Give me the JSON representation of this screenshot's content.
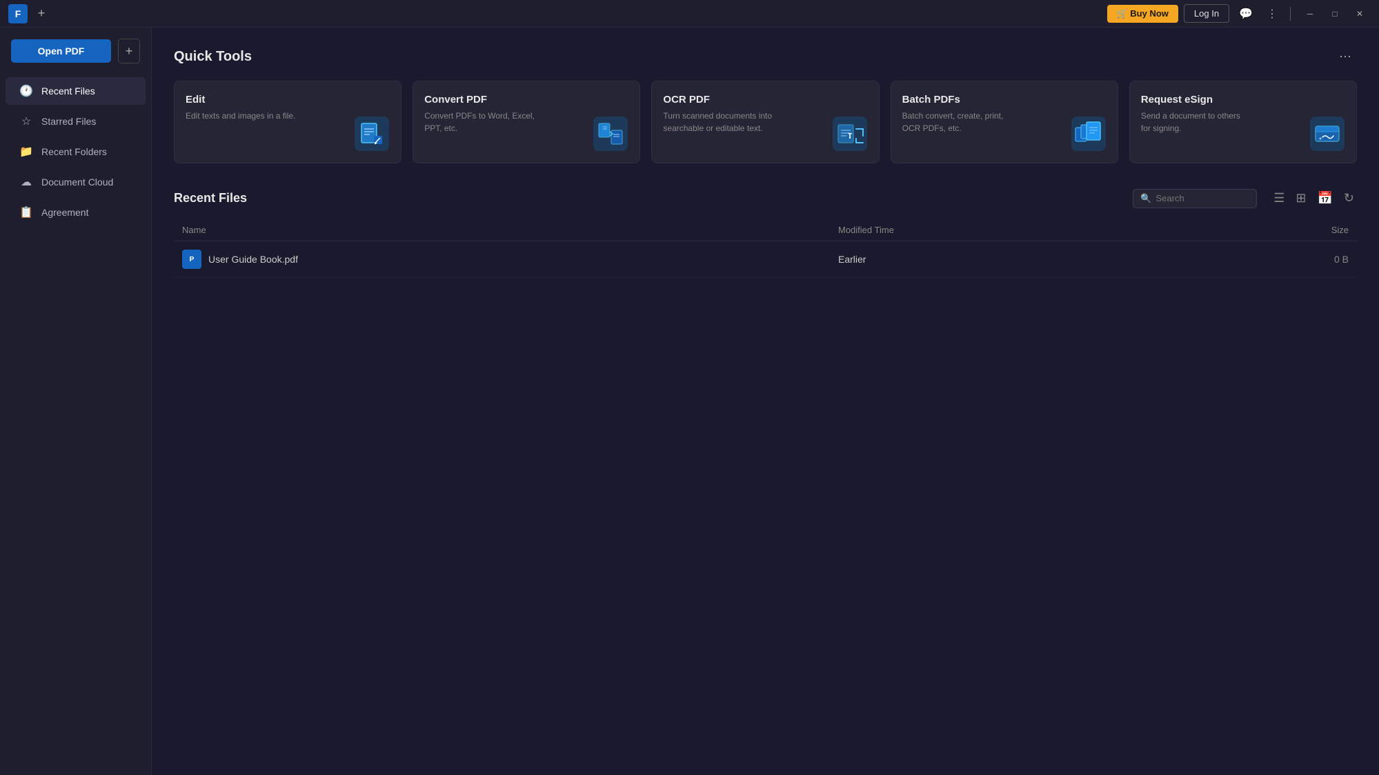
{
  "titlebar": {
    "logo_text": "F",
    "new_tab_label": "+",
    "buy_now_label": "🛒 Buy Now",
    "login_label": "Log In",
    "chat_icon": "💬",
    "more_icon": "⋮",
    "minimize_icon": "─",
    "maximize_icon": "□",
    "close_icon": "✕"
  },
  "sidebar": {
    "open_pdf_label": "Open PDF",
    "add_label": "+",
    "items": [
      {
        "id": "recent-files",
        "icon": "🕐",
        "label": "Recent Files"
      },
      {
        "id": "starred-files",
        "icon": "☆",
        "label": "Starred Files"
      },
      {
        "id": "recent-folders",
        "icon": "📁",
        "label": "Recent Folders"
      },
      {
        "id": "document-cloud",
        "icon": "☁",
        "label": "Document Cloud"
      },
      {
        "id": "agreement",
        "icon": "📋",
        "label": "Agreement"
      }
    ]
  },
  "quick_tools": {
    "section_title": "Quick Tools",
    "more_icon": "⋯",
    "cards": [
      {
        "id": "edit",
        "title": "Edit",
        "description": "Edit texts and images in a file."
      },
      {
        "id": "convert-pdf",
        "title": "Convert PDF",
        "description": "Convert PDFs to Word, Excel, PPT, etc."
      },
      {
        "id": "ocr-pdf",
        "title": "OCR PDF",
        "description": "Turn scanned documents into searchable or editable text."
      },
      {
        "id": "batch-pdfs",
        "title": "Batch PDFs",
        "description": "Batch convert, create, print, OCR PDFs, etc."
      },
      {
        "id": "request-esign",
        "title": "Request eSign",
        "description": "Send a document to others for signing."
      }
    ]
  },
  "recent_files": {
    "section_title": "Recent Files",
    "search_placeholder": "Search",
    "columns": {
      "name": "Name",
      "modified_time": "Modified Time",
      "size": "Size"
    },
    "files": [
      {
        "name": "User Guide Book.pdf",
        "modified_time": "Earlier",
        "size": "0 B"
      }
    ]
  }
}
